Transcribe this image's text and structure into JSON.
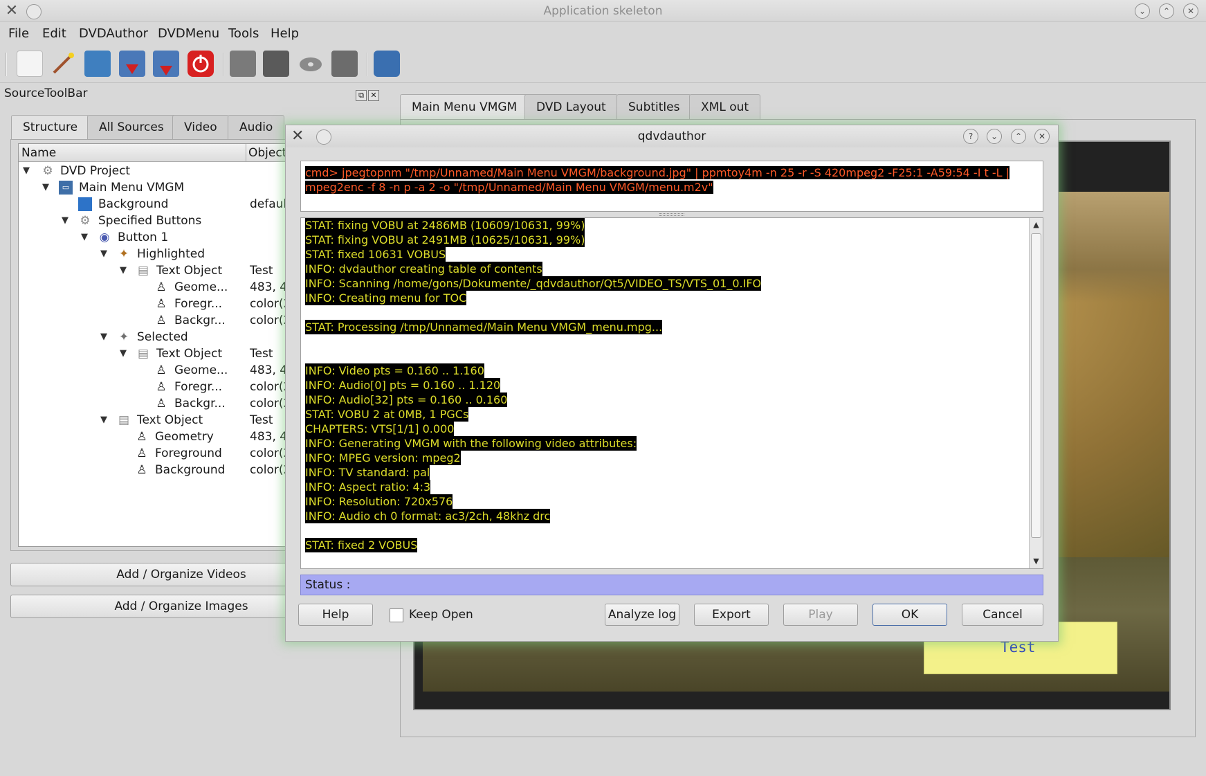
{
  "window": {
    "title": "Application skeleton"
  },
  "menubar": {
    "items": [
      "File",
      "Edit",
      "DVDAuthor",
      "DVDMenu",
      "Tools",
      "Help"
    ]
  },
  "toolbar": {
    "icons": [
      "new-document-icon",
      "wizard-wand-icon",
      "properties-icon",
      "import-icon",
      "export-icon",
      "power-off-icon",
      "movie-strip-icon",
      "dvd-drive-icon",
      "disc-icon",
      "film-settings-icon",
      "burn-icon"
    ]
  },
  "dock": {
    "title": "SourceToolBar",
    "tabs": [
      "Structure",
      "All Sources",
      "Video",
      "Audio"
    ],
    "columns": [
      "Name",
      "Object"
    ],
    "tree": [
      {
        "label": "DVD Project",
        "value": "",
        "icon": "project-icon"
      },
      {
        "label": "Main Menu VMGM",
        "value": "",
        "icon": "menu-icon"
      },
      {
        "label": "Background",
        "value": "defaul",
        "icon": "image-icon"
      },
      {
        "label": "Specified Buttons",
        "value": "",
        "icon": "buttons-icon"
      },
      {
        "label": "Button 1",
        "value": "",
        "icon": "button-icon"
      },
      {
        "label": "Highlighted",
        "value": "",
        "icon": "highlight-icon"
      },
      {
        "label": "Text Object",
        "value": "Test",
        "icon": "text-object-icon"
      },
      {
        "label": "Geome...",
        "value": "483, 4",
        "icon": "penguin-icon"
      },
      {
        "label": "Foregr...",
        "value": "color(2",
        "icon": "penguin-icon"
      },
      {
        "label": "Backgr...",
        "value": "color(2",
        "icon": "penguin-icon"
      },
      {
        "label": "Selected",
        "value": "",
        "icon": "selected-icon"
      },
      {
        "label": "Text Object",
        "value": "Test",
        "icon": "text-object-icon"
      },
      {
        "label": "Geome...",
        "value": "483, 4",
        "icon": "penguin-icon"
      },
      {
        "label": "Foregr...",
        "value": "color(2",
        "icon": "penguin-icon"
      },
      {
        "label": "Backgr...",
        "value": "color(2",
        "icon": "penguin-icon"
      },
      {
        "label": "Text Object",
        "value": "Test",
        "icon": "text-object-icon"
      },
      {
        "label": "Geometry",
        "value": "483, 4",
        "icon": "penguin-icon"
      },
      {
        "label": "Foreground",
        "value": "color(2",
        "icon": "penguin-icon"
      },
      {
        "label": "Background",
        "value": "color(2",
        "icon": "penguin-icon"
      }
    ],
    "buttons": [
      "Add / Organize Videos",
      "Add / Organize Images"
    ]
  },
  "main": {
    "tabs": [
      "Main Menu VMGM",
      "DVD Layout",
      "Subtitles",
      "XML out"
    ],
    "preview_text": "Test"
  },
  "dialog": {
    "title": "qdvdauthor",
    "cmd": "cmd> jpegtopnm \"/tmp/Unnamed/Main Menu VMGM/background.jpg\" | ppmtoy4m -n 25 -r -S 420mpeg2 -F25:1 -A59:54 -I t -L | mpeg2enc -f 8 -n p -a 2 -o \"/tmp/Unnamed/Main Menu VMGM/menu.m2v\"",
    "log": [
      "STAT: fixing VOBU at 2486MB (10609/10631, 99%)",
      "STAT: fixing VOBU at 2491MB (10625/10631, 99%)",
      "STAT: fixed 10631 VOBUS",
      "INFO: dvdauthor creating table of contents",
      "INFO: Scanning /home/gons/Dokumente/_qdvdauthor/Qt5/VIDEO_TS/VTS_01_0.IFO",
      "INFO: Creating menu for TOC",
      "",
      "STAT: Processing /tmp/Unnamed/Main Menu VMGM_menu.mpg...",
      "",
      "",
      "INFO: Video pts = 0.160 .. 1.160",
      "INFO: Audio[0] pts = 0.160 .. 1.120",
      "INFO: Audio[32] pts = 0.160 .. 0.160",
      "STAT: VOBU 2 at 0MB, 1 PGCs",
      "CHAPTERS: VTS[1/1] 0.000",
      "INFO: Generating VMGM with the following video attributes:",
      "INFO: MPEG version: mpeg2",
      "INFO: TV standard: pal",
      "INFO: Aspect ratio: 4:3",
      "INFO: Resolution: 720x576",
      "INFO: Audio ch 0 format: ac3/2ch,  48khz drc",
      "",
      "STAT: fixed 2 VOBUS"
    ],
    "status_label": "Status :",
    "keep_open_label": "Keep Open",
    "buttons": {
      "help": "Help",
      "analyze": "Analyze log",
      "export": "Export",
      "play": "Play",
      "ok": "OK",
      "cancel": "Cancel"
    }
  },
  "colors": {
    "log_text": "#dcdc2a",
    "cmd_text": "#ff5a28",
    "status_bg": "#a7a9f2",
    "test_box": "#f3f18a"
  }
}
